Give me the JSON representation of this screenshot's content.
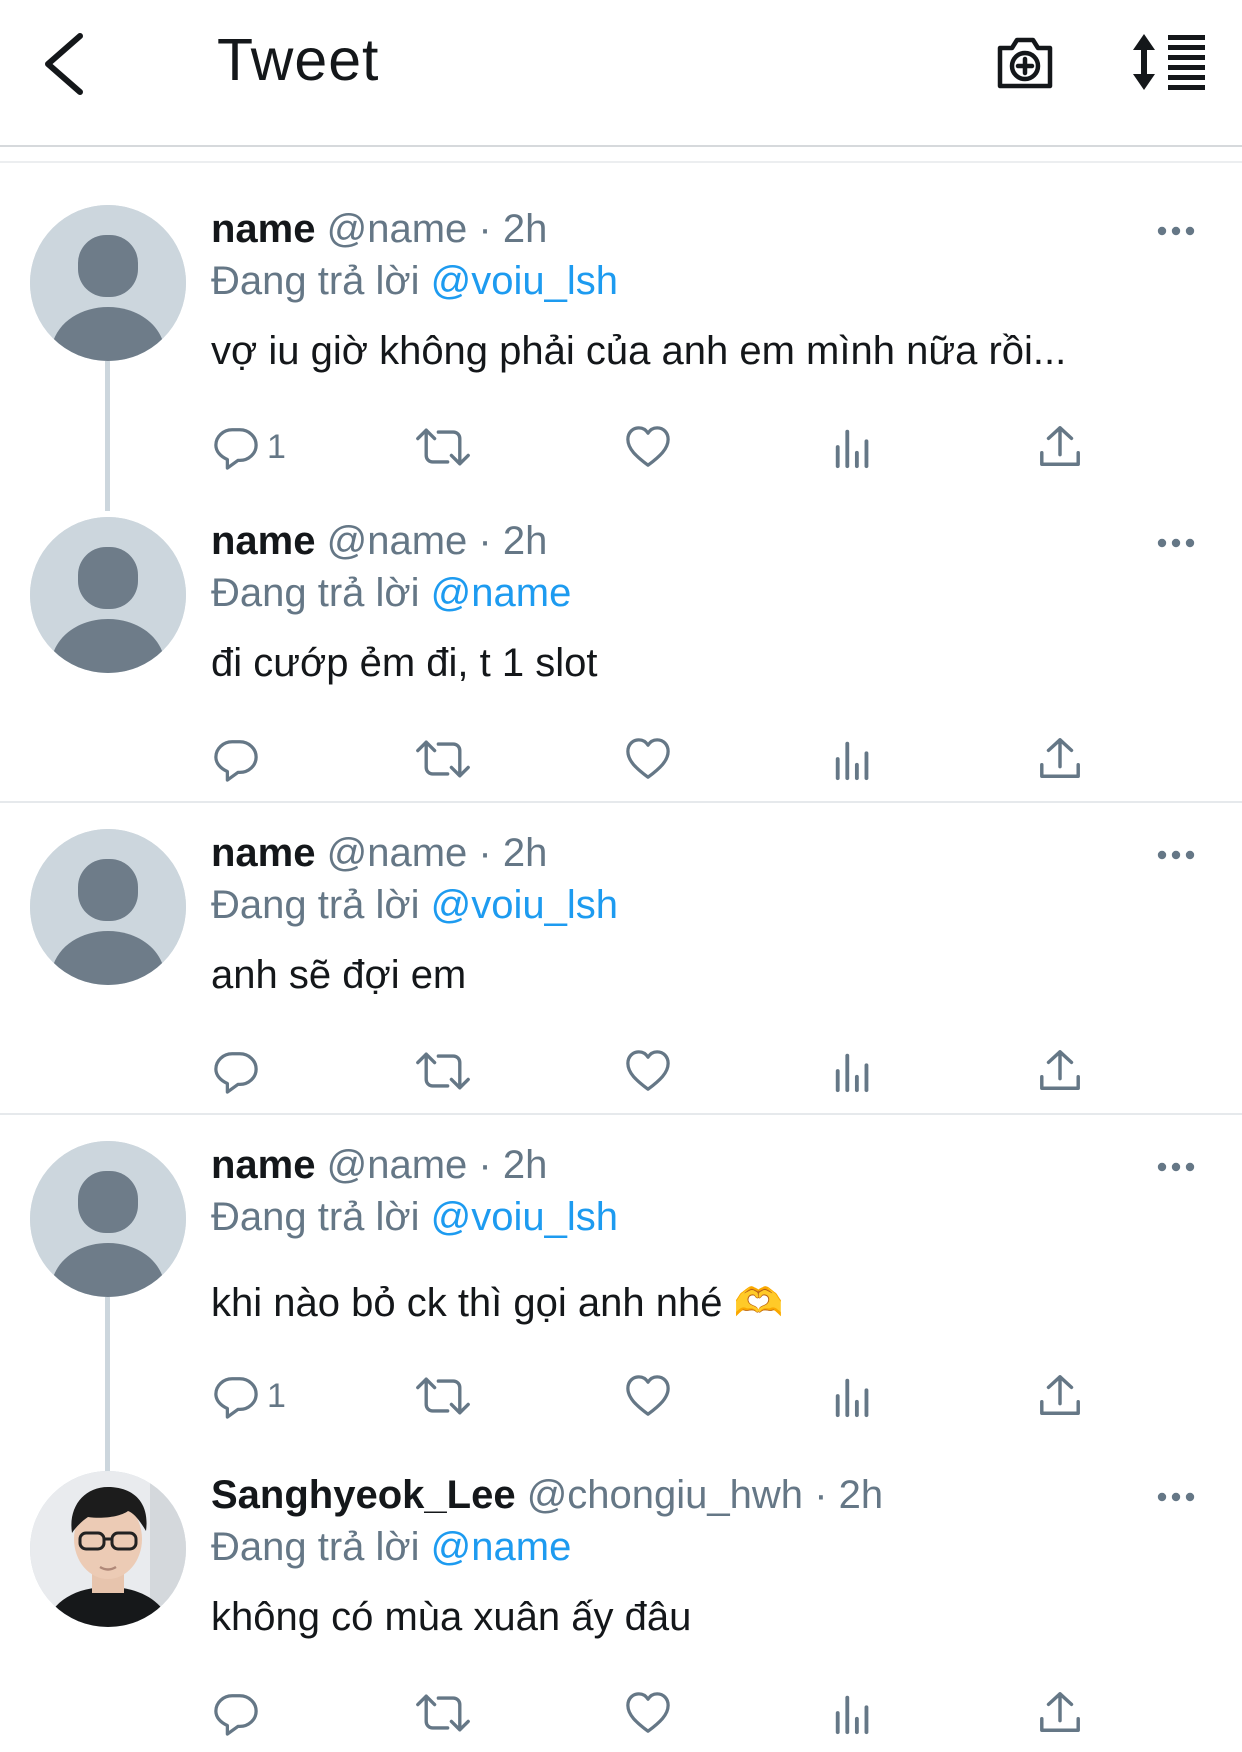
{
  "header": {
    "title": "Tweet",
    "back_icon": "back-arrow-icon",
    "camera_icon": "camera-plus-icon",
    "sort_icon": "sort-icon"
  },
  "colors": {
    "accent": "#1d9bf0",
    "secondary_text": "#657786",
    "primary_text": "#14171a",
    "avatar_bg": "#ccd6dd",
    "avatar_fg": "#6e7c89"
  },
  "tweets": [
    {
      "name": "name",
      "handle": "@name",
      "time": "· 2h",
      "reply_prefix": "Đang trả lời",
      "reply_to": "@voiu_lsh",
      "text": "vợ iu giờ không phải của anh em mình nữa rồi...",
      "reply_count": "1"
    },
    {
      "name": "name",
      "handle": "@name",
      "time": "· 2h",
      "reply_prefix": "Đang trả lời",
      "reply_to": "@name",
      "text": "đi cướp ẻm đi, t 1 slot",
      "reply_count": ""
    },
    {
      "name": "name",
      "handle": "@name",
      "time": "· 2h",
      "reply_prefix": "Đang trả lời",
      "reply_to": "@voiu_lsh",
      "text": "anh sẽ đợi em",
      "reply_count": ""
    },
    {
      "name": "name",
      "handle": "@name",
      "time": "· 2h",
      "reply_prefix": "Đang trả lời",
      "reply_to": "@voiu_lsh",
      "text": "khi nào bỏ ck thì gọi anh nhé 🫶",
      "reply_count": "1"
    },
    {
      "name": "Sanghyeok_Lee",
      "handle": "@chongiu_hwh",
      "time": "· 2h",
      "reply_prefix": "Đang trả lời",
      "reply_to": "@name",
      "text": "không có mùa xuân ấy đâu",
      "reply_count": ""
    }
  ]
}
